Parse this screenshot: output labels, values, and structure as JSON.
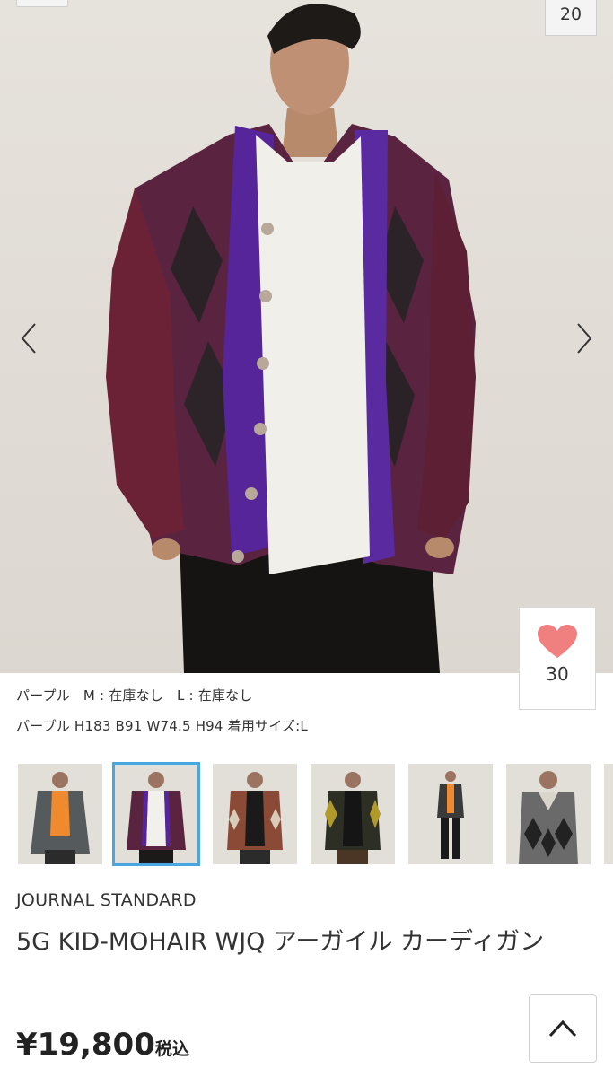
{
  "gallery": {
    "image_counter": "20",
    "prev_icon": "chevron-left-icon",
    "next_icon": "chevron-right-icon"
  },
  "favorite": {
    "icon": "heart-icon",
    "count": "30",
    "heart_color": "#f07f7f"
  },
  "stock": {
    "color": "パープル",
    "sizes": [
      "M : 在庫なし",
      "L : 在庫なし"
    ]
  },
  "model_info": "パープル H183 B91 W74.5 H94 着用サイズ:L",
  "thumbnails": [
    {
      "color": "gray",
      "selected": false
    },
    {
      "color": "purple",
      "selected": true
    },
    {
      "color": "brown",
      "selected": false
    },
    {
      "color": "olive",
      "selected": false
    },
    {
      "color": "gray-black",
      "selected": false
    },
    {
      "color": "gray-black-v",
      "selected": false
    }
  ],
  "accent_color": "#48a7e0",
  "product": {
    "brand": "JOURNAL STANDARD",
    "title": "5G KID-MOHAIR WJQ アーガイル カーディガン",
    "price": "¥19,800",
    "tax_label": "税込"
  },
  "scroll_top_icon": "chevron-up-icon"
}
